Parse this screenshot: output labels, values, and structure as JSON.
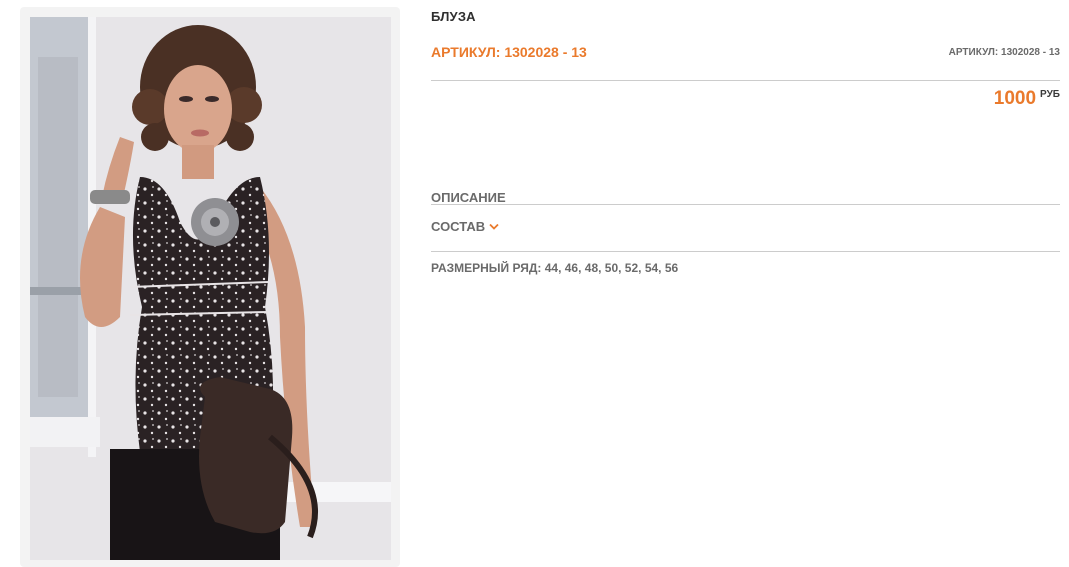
{
  "product": {
    "title": "БЛУЗА",
    "article_main": "АРТИКУЛ: 1302028 - 13",
    "article_small": "АРТИКУЛ: 1302028 - 13",
    "price_value": "1000",
    "price_currency": "РУБ"
  },
  "sections": {
    "description_label": "ОПИСАНИЕ",
    "composition_label": "СОСТАВ",
    "composition_icon": "chevron-down-icon"
  },
  "sizes": {
    "label": "РАЗМЕРНЫЙ РЯД:",
    "values": "44, 46, 48, 50, 52, 54, 56"
  },
  "colors": {
    "accent": "#ea7a2c",
    "text_dark": "#2f2f2f",
    "text_muted": "#6a6a6a",
    "divider": "#cccccc"
  }
}
